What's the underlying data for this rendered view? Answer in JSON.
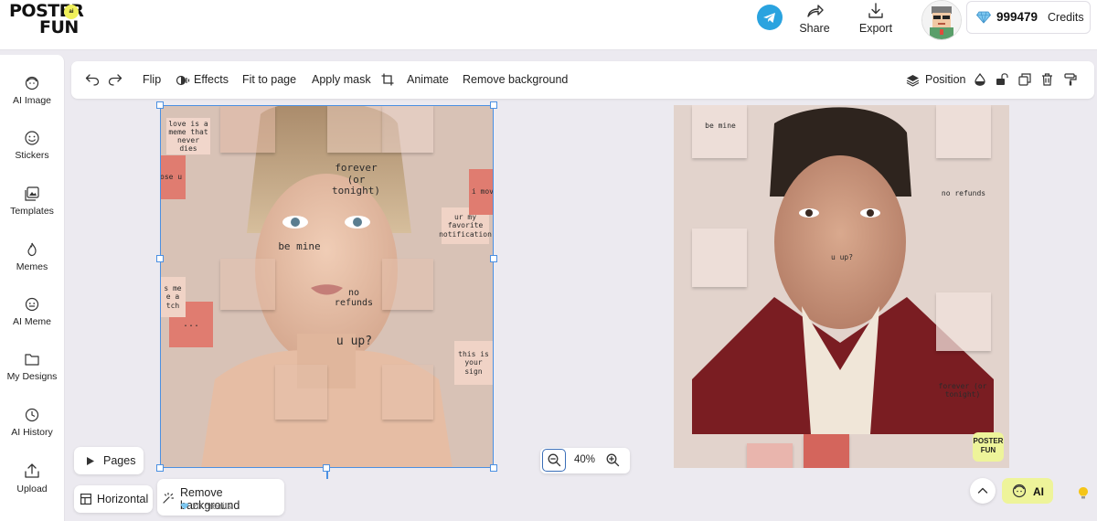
{
  "brand": {
    "logo_line1": "POSTER",
    "logo_line2": "FUN",
    "logo_badge": "ai"
  },
  "topbar": {
    "share_label": "Share",
    "export_label": "Export",
    "credits_value": "999479",
    "credits_label": "Credits"
  },
  "sidebar": {
    "items": [
      {
        "label": "AI Image",
        "icon": "ai-face-icon"
      },
      {
        "label": "Stickers",
        "icon": "smiley-icon"
      },
      {
        "label": "Templates",
        "icon": "templates-icon"
      },
      {
        "label": "Memes",
        "icon": "flame-icon"
      },
      {
        "label": "AI Meme",
        "icon": "ai-smiley-icon"
      },
      {
        "label": "My Designs",
        "icon": "folder-icon"
      },
      {
        "label": "AI History",
        "icon": "history-icon"
      },
      {
        "label": "Upload",
        "icon": "upload-icon"
      }
    ]
  },
  "toolbar": {
    "flip": "Flip",
    "effects": "Effects",
    "fit_to_page": "Fit to page",
    "apply_mask": "Apply mask",
    "animate": "Animate",
    "remove_background": "Remove background",
    "position": "Position"
  },
  "canvas_left": {
    "notes": [
      "love is a meme that never dies",
      "forever (or tonight)",
      "be mine",
      "ur my favorite notification",
      "no refunds",
      "u up?",
      "...",
      "this is your sign",
      "ose u",
      "i mov",
      "s me e a tch"
    ]
  },
  "canvas_right": {
    "notes": [
      "be mine",
      "no refunds",
      "u up?",
      "forever (or tonight)"
    ],
    "watermark_line1": "POSTER",
    "watermark_line2": "FUN"
  },
  "bottom": {
    "pages_label": "Pages",
    "horizontal_label": "Horizontal",
    "remove_bg_label": "Remove background",
    "remove_bg_cost": "20 credits",
    "zoom_level": "40%",
    "ai_label": "AI"
  },
  "colors": {
    "selection": "#4b90e2",
    "ai_button": "#eef49a",
    "telegram": "#2aa3df",
    "note_pink": "#e07c70"
  }
}
